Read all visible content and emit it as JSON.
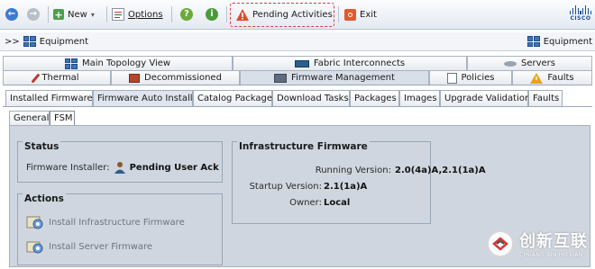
{
  "toolbar": {
    "new_label": "New",
    "options_label": "Options",
    "pending_label": "Pending Activities",
    "exit_label": "Exit",
    "brand_text": "CISCO"
  },
  "breadcrumb": {
    "prefix": ">>",
    "current": "Equipment",
    "right_label": "Equipment"
  },
  "tabs_row1": [
    {
      "label": "Main Topology View"
    },
    {
      "label": "Fabric Interconnects"
    },
    {
      "label": "Servers"
    }
  ],
  "tabs_row2": [
    {
      "label": "Thermal"
    },
    {
      "label": "Decommissioned"
    },
    {
      "label": "Firmware Management"
    },
    {
      "label": "Policies"
    },
    {
      "label": "Faults"
    }
  ],
  "subtabs": [
    {
      "label": "Installed Firmware"
    },
    {
      "label": "Firmware Auto Install"
    },
    {
      "label": "Catalog Package"
    },
    {
      "label": "Download Tasks"
    },
    {
      "label": "Packages"
    },
    {
      "label": "Images"
    },
    {
      "label": "Upgrade Validation"
    },
    {
      "label": "Faults"
    }
  ],
  "minitabs": [
    {
      "label": "General"
    },
    {
      "label": "FSM"
    }
  ],
  "status": {
    "title": "Status",
    "installer_label": "Firmware Installer:",
    "installer_value": "Pending User Ack"
  },
  "actions": {
    "title": "Actions",
    "install_infra": "Install Infrastructure Firmware",
    "install_server": "Install Server Firmware"
  },
  "infra": {
    "title": "Infrastructure Firmware",
    "running_label": "Running Version:",
    "running_value": "2.0(4a)A,2.1(1a)A",
    "startup_label": "Startup Version:",
    "startup_value": "2.1(1a)A",
    "owner_label": "Owner:",
    "owner_value": "Local"
  },
  "watermark": {
    "main": "创新互联",
    "sub": "CHUANG XIN HU LIAN"
  },
  "colors": {
    "accent_blue": "#2f63a8",
    "warn_red": "#d84040",
    "help_green": "#4aa04a",
    "panel_bg": "#cfd6df"
  }
}
